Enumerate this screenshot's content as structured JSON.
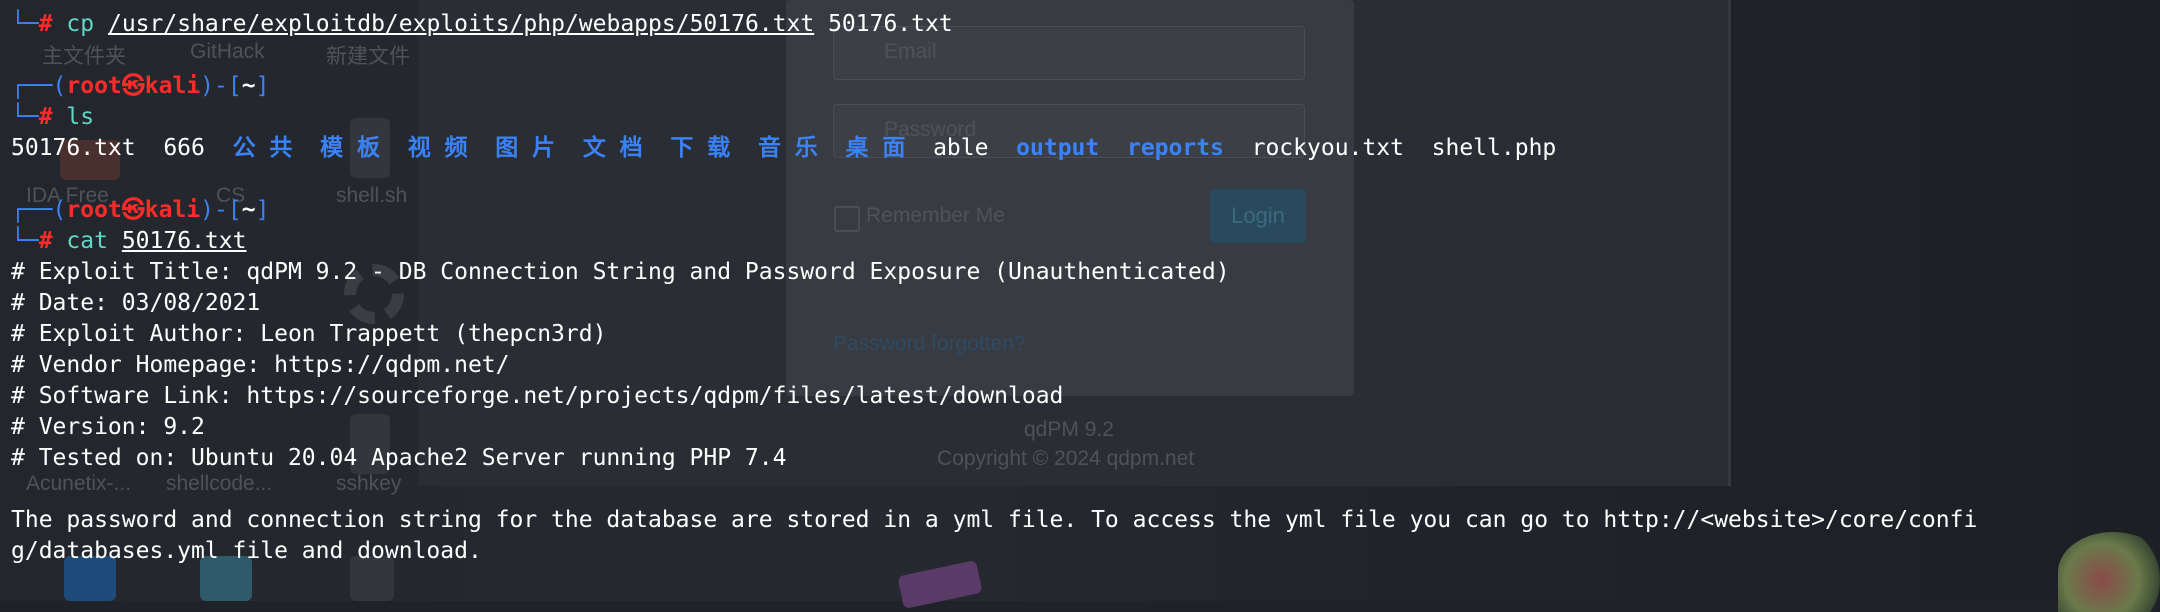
{
  "desktop_background": {
    "icon_labels": [
      "主文件夹",
      "GitHack",
      "新建文件",
      "IDA Free",
      "CS",
      "shell.sh",
      "Acunetix-...",
      "shellcode...",
      "sshkey"
    ],
    "login_form": {
      "email_placeholder": "Email",
      "password_placeholder": "Password",
      "remember_label": "Remember Me",
      "login_button": "Login",
      "forgot_link": "Password forgotten?",
      "footer_version": "qdPM 9.2",
      "footer_copyright": "Copyright © 2024 qdpm.net"
    }
  },
  "terminal": {
    "prompt": {
      "user": "root",
      "at": "㉿",
      "host": "kali",
      "cwd": "~",
      "hash": "#"
    },
    "cmd1": {
      "command": "cp",
      "source": "/usr/share/exploitdb/exploits/php/webapps/50176.txt",
      "dest": "50176.txt"
    },
    "cmd2": {
      "command": "ls"
    },
    "ls_output": [
      {
        "name": "50176.txt",
        "kind": "file"
      },
      {
        "name": "666",
        "kind": "file"
      },
      {
        "name": "公共",
        "kind": "dir"
      },
      {
        "name": "模板",
        "kind": "dir"
      },
      {
        "name": "视频",
        "kind": "dir"
      },
      {
        "name": "图片",
        "kind": "dir"
      },
      {
        "name": "文档",
        "kind": "dir"
      },
      {
        "name": "下载",
        "kind": "dir"
      },
      {
        "name": "音乐",
        "kind": "dir"
      },
      {
        "name": "桌面",
        "kind": "dir"
      },
      {
        "name": "able",
        "kind": "file"
      },
      {
        "name": "output",
        "kind": "dir"
      },
      {
        "name": "reports",
        "kind": "dir"
      },
      {
        "name": "rockyou.txt",
        "kind": "file"
      },
      {
        "name": "shell.php",
        "kind": "file"
      }
    ],
    "cmd3": {
      "command": "cat",
      "arg": "50176.txt"
    },
    "cat_output": [
      "# Exploit Title: qdPM 9.2 - DB Connection String and Password Exposure (Unauthenticated)",
      "# Date: 03/08/2021",
      "# Exploit Author: Leon Trappett (thepcn3rd)",
      "# Vendor Homepage: https://qdpm.net/",
      "# Software Link: https://sourceforge.net/projects/qdpm/files/latest/download",
      "# Version: 9.2",
      "# Tested on: Ubuntu 20.04 Apache2 Server running PHP 7.4",
      "",
      "The password and connection string for the database are stored in a yml file. To access the yml file you can go to http://<website>/core/confi",
      "g/databases.yml file and download."
    ]
  }
}
